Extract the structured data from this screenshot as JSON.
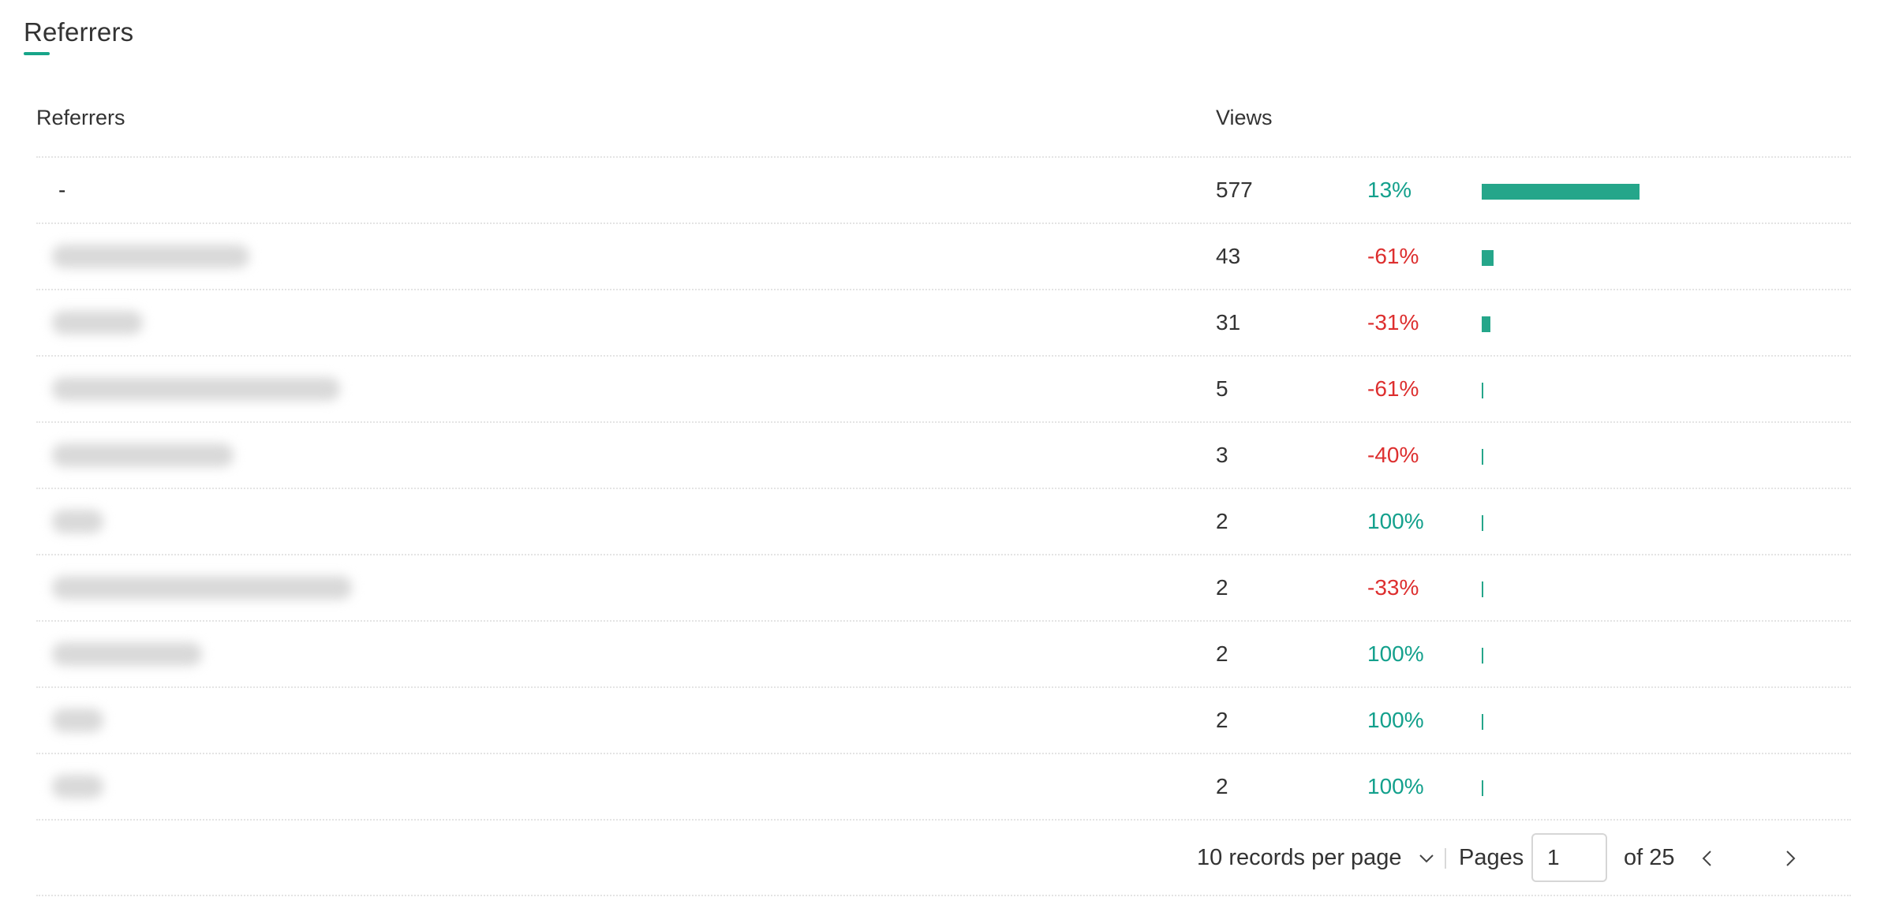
{
  "section": {
    "title": "Referrers"
  },
  "table": {
    "columns": {
      "referrer": "Referrers",
      "views": "Views"
    },
    "accent_color": "#25a68a",
    "positive_color": "#13a08c",
    "negative_color": "#dd2f2f",
    "rows": [
      {
        "referrer": "-",
        "blurred": false,
        "views": "577",
        "change": "13%",
        "trend": "up",
        "share": 1.0
      },
      {
        "referrer": "",
        "blurred": true,
        "views": "43",
        "change": "-61%",
        "trend": "down",
        "share": 0.075
      },
      {
        "referrer": "",
        "blurred": true,
        "views": "31",
        "change": "-31%",
        "trend": "down",
        "share": 0.054
      },
      {
        "referrer": "",
        "blurred": true,
        "views": "5",
        "change": "-61%",
        "trend": "down",
        "share": 0.009
      },
      {
        "referrer": "",
        "blurred": true,
        "views": "3",
        "change": "-40%",
        "trend": "down",
        "share": 0.005
      },
      {
        "referrer": "",
        "blurred": true,
        "views": "2",
        "change": "100%",
        "trend": "up",
        "share": 0.0035
      },
      {
        "referrer": "",
        "blurred": true,
        "views": "2",
        "change": "-33%",
        "trend": "down",
        "share": 0.0035
      },
      {
        "referrer": "",
        "blurred": true,
        "views": "2",
        "change": "100%",
        "trend": "up",
        "share": 0.0035
      },
      {
        "referrer": "",
        "blurred": true,
        "views": "2",
        "change": "100%",
        "trend": "up",
        "share": 0.0035
      },
      {
        "referrer": "",
        "blurred": true,
        "views": "2",
        "change": "100%",
        "trend": "up",
        "share": 0.0035
      }
    ]
  },
  "pagination": {
    "page_size_label": "10 records per page",
    "pages_label": "Pages",
    "current_page": "1",
    "of_label": "of 25",
    "prev_icon": "chevron-left-icon",
    "next_icon": "chevron-right-icon"
  }
}
